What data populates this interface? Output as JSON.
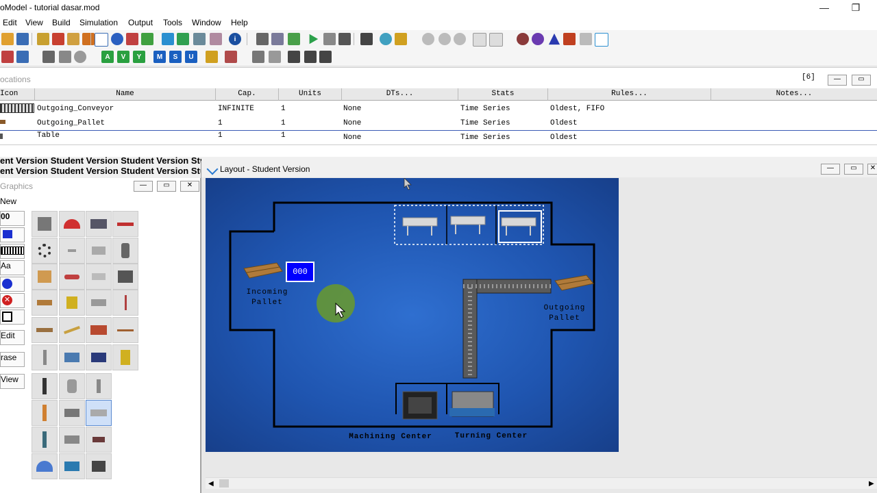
{
  "window": {
    "title": "oModel - tutorial dasar.mod"
  },
  "menu": [
    "Edit",
    "View",
    "Build",
    "Simulation",
    "Output",
    "Tools",
    "Window",
    "Help"
  ],
  "locations": {
    "panel_title": "ocations",
    "count": "[6]",
    "columns": [
      "Icon",
      "Name",
      "Cap.",
      "Units",
      "DTs...",
      "Stats",
      "Rules...",
      "Notes..."
    ],
    "rows": [
      {
        "name": "Outgoing_Conveyor",
        "cap": "INFINITE",
        "units": "1",
        "dts": "None",
        "stats": "Time Series",
        "rules": "Oldest, FIFO"
      },
      {
        "name": "Outgoing_Pallet",
        "cap": "1",
        "units": "1",
        "dts": "None",
        "stats": "Time Series",
        "rules": "Oldest"
      },
      {
        "name": "Table",
        "cap": "1",
        "units": "1",
        "dts": "None",
        "stats": "Time Series",
        "rules": "Oldest"
      }
    ]
  },
  "watermark": {
    "line1": "ent Version Student Version Student Version Student",
    "line2": "ent Version Student Version Student Version Student"
  },
  "graphics": {
    "title": "Graphics",
    "new_label": "New",
    "counter_label": "00",
    "text_label": "Aa",
    "edit_label": "Edit",
    "erase_label": "rase",
    "view_label": "View"
  },
  "layout": {
    "title": "Layout - Student Version",
    "counter": "000",
    "labels": {
      "incoming_line1": "Incoming",
      "incoming_line2": "Pallet",
      "outgoing_line1": "Outgoing",
      "outgoing_line2": "Pallet",
      "machining": "Machining Center",
      "turning": "Turning Center"
    }
  }
}
